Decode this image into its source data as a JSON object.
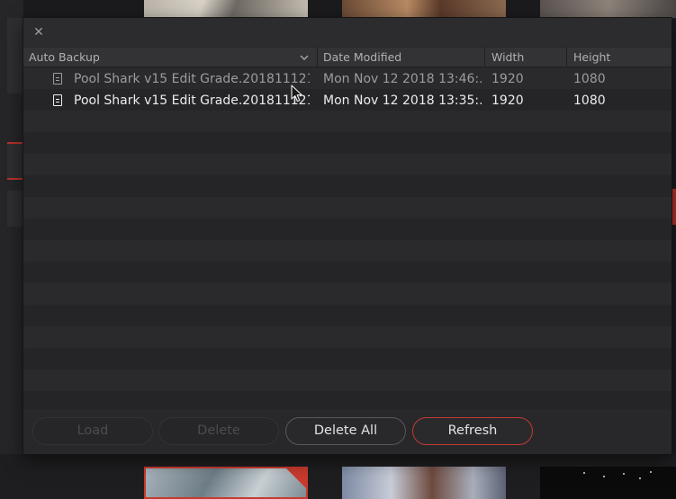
{
  "dialog": {
    "close_glyph": "✕",
    "columns": {
      "name": "Auto Backup",
      "date": "Date Modified",
      "width": "Width",
      "height": "Height"
    },
    "files": [
      {
        "name": "Pool Shark v15 Edit Grade.201811121...",
        "date": "Mon Nov 12 2018 13:46:...",
        "width": "1920",
        "height": "1080"
      },
      {
        "name": "Pool Shark v15 Edit Grade.201811121...",
        "date": "Mon Nov 12 2018 13:35:...",
        "width": "1920",
        "height": "1080"
      }
    ],
    "buttons": {
      "load": "Load",
      "delete": "Delete",
      "delete_all": "Delete All",
      "refresh": "Refresh"
    }
  },
  "colors": {
    "accent": "#c23a30",
    "panel": "#28282b"
  },
  "icons": {
    "close": "close-icon",
    "sort": "chevron-down-icon",
    "file": "document-icon",
    "pointer": "mouse-pointer-icon"
  }
}
